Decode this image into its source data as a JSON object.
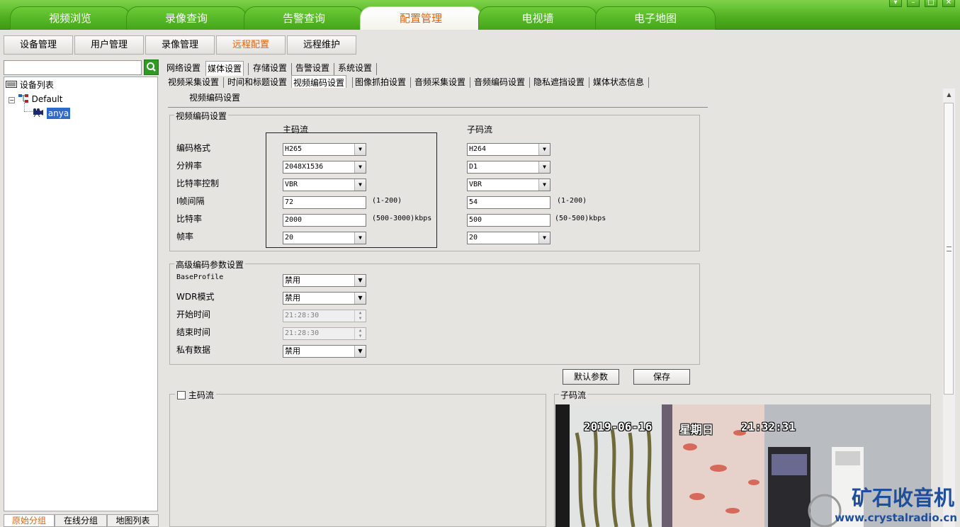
{
  "window_controls": [
    "▾",
    "–",
    "□",
    "✕"
  ],
  "main_tabs": [
    {
      "label": "视频浏览",
      "active": false
    },
    {
      "label": "录像查询",
      "active": false
    },
    {
      "label": "告警查询",
      "active": false
    },
    {
      "label": "配置管理",
      "active": true
    },
    {
      "label": "电视墙",
      "active": false
    },
    {
      "label": "电子地图",
      "active": false
    }
  ],
  "sub_buttons": [
    {
      "label": "设备管理",
      "active": false
    },
    {
      "label": "用户管理",
      "active": false
    },
    {
      "label": "录像管理",
      "active": false
    },
    {
      "label": "远程配置",
      "active": true
    },
    {
      "label": "远程维护",
      "active": false
    }
  ],
  "left": {
    "search_value": "",
    "tree_root": "设备列表",
    "tree_group": "Default",
    "tree_device": "anya",
    "bottom_tabs": [
      "原始分组",
      "在线分组",
      "地图列表"
    ]
  },
  "tabs_row1": [
    {
      "label": "网络设置",
      "active": false
    },
    {
      "label": "媒体设置",
      "active": true
    },
    {
      "label": "存储设置",
      "active": false
    },
    {
      "label": "告警设置",
      "active": false
    },
    {
      "label": "系统设置",
      "active": false
    }
  ],
  "tabs_row2": [
    {
      "label": "视频采集设置",
      "active": false
    },
    {
      "label": "时间和标题设置",
      "active": false
    },
    {
      "label": "视频编码设置",
      "active": true
    },
    {
      "label": "图像抓拍设置",
      "active": false
    },
    {
      "label": "音频采集设置",
      "active": false
    },
    {
      "label": "音频编码设置",
      "active": false
    },
    {
      "label": "隐私遮挡设置",
      "active": false
    },
    {
      "label": "媒体状态信息",
      "active": false
    }
  ],
  "page_heading": "视频编码设置",
  "encoding": {
    "legend": "视频编码设置",
    "main_stream_header": "主码流",
    "sub_stream_header": "子码流",
    "labels": [
      "编码格式",
      "分辨率",
      "比特率控制",
      "I帧间隔",
      "比特率",
      "帧率"
    ],
    "main": {
      "codec": "H265",
      "resolution": "2048X1536",
      "bitrate_control": "VBR",
      "i_frame_interval": "72",
      "i_frame_range": "(1-200)",
      "bitrate": "2000",
      "bitrate_range": "(500-3000)kbps",
      "framerate": "20"
    },
    "sub": {
      "codec": "H264",
      "resolution": "D1",
      "bitrate_control": "VBR",
      "i_frame_interval": "54",
      "i_frame_range": "(1-200)",
      "bitrate": "500",
      "bitrate_range": "(50-500)kbps",
      "framerate": "20"
    }
  },
  "advanced": {
    "legend": "高级编码参数设置",
    "labels": [
      "BaseProfile",
      "WDR模式",
      "开始时间",
      "结束时间",
      "私有数据"
    ],
    "base_profile": "禁用",
    "wdr_mode": "禁用",
    "start_time": "21:28:30",
    "end_time": "21:28:30",
    "private_data": "禁用"
  },
  "buttons": {
    "defaults": "默认参数",
    "save": "保存"
  },
  "preview": {
    "main_label": "主码流",
    "main_checked": false,
    "sub_label": "子码流",
    "osd_date": "2019-06-16",
    "osd_weekday": "星期日",
    "osd_time": "21:32:31"
  },
  "watermark": {
    "title": "矿石收音机",
    "url": "www.crystalradio.cn"
  }
}
